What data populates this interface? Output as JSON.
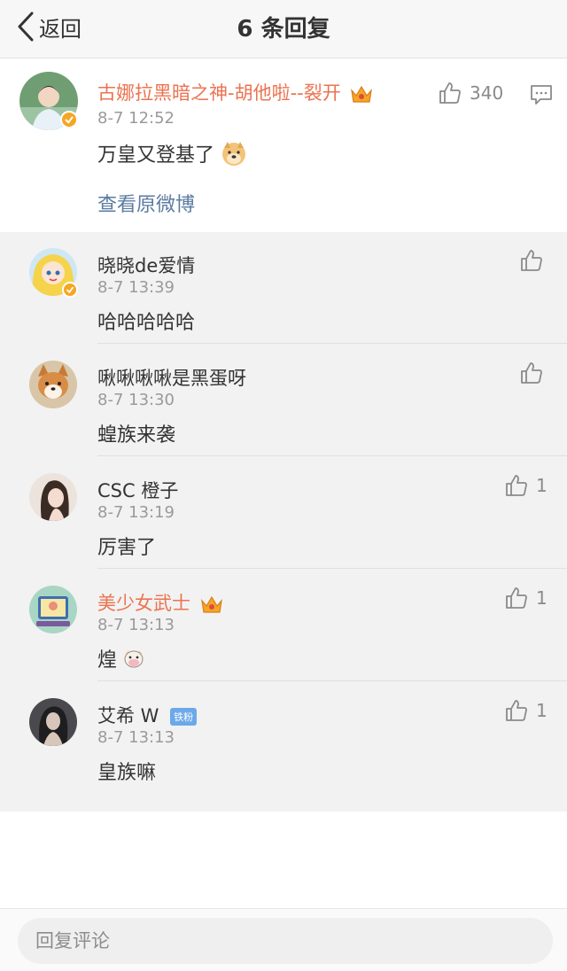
{
  "nav": {
    "back_label": "返回",
    "title": "6 条回复"
  },
  "main_comment": {
    "author": "古娜拉黑暗之神-胡他啦--裂开",
    "time": "8-7 12:52",
    "text": "万皇又登基了",
    "likes": "340",
    "view_original": "查看原微博",
    "icons": [
      "verified-badge-icon",
      "vip-crown-icon",
      "doge-emoji-icon",
      "thumb-up-icon",
      "comment-icon"
    ]
  },
  "replies": [
    {
      "author": "晓晓de爱情",
      "time": "8-7 13:39",
      "text": "哈哈哈哈哈",
      "likes": "",
      "name_color": "dark"
    },
    {
      "author": "啾啾啾啾是黑蛋呀",
      "time": "8-7 13:30",
      "text": "蝗族来袭",
      "likes": "",
      "name_color": "dark"
    },
    {
      "author": "CSC 橙子",
      "time": "8-7 13:19",
      "text": "厉害了",
      "likes": "1",
      "name_color": "dark"
    },
    {
      "author": "美少女武士",
      "time": "8-7 13:13",
      "text": "煌",
      "likes": "1",
      "name_color": "orange"
    },
    {
      "author": "艾希 W",
      "time": "8-7 13:13",
      "text": "皇族嘛",
      "likes": "1",
      "name_color": "dark",
      "badge": "铁粉"
    }
  ],
  "bottom": {
    "placeholder": "回复评论"
  },
  "colors": {
    "accent_name": "#eb7350",
    "link": "#5b7ba1",
    "muted": "#9a9a9a",
    "verified": "#f5a623"
  }
}
